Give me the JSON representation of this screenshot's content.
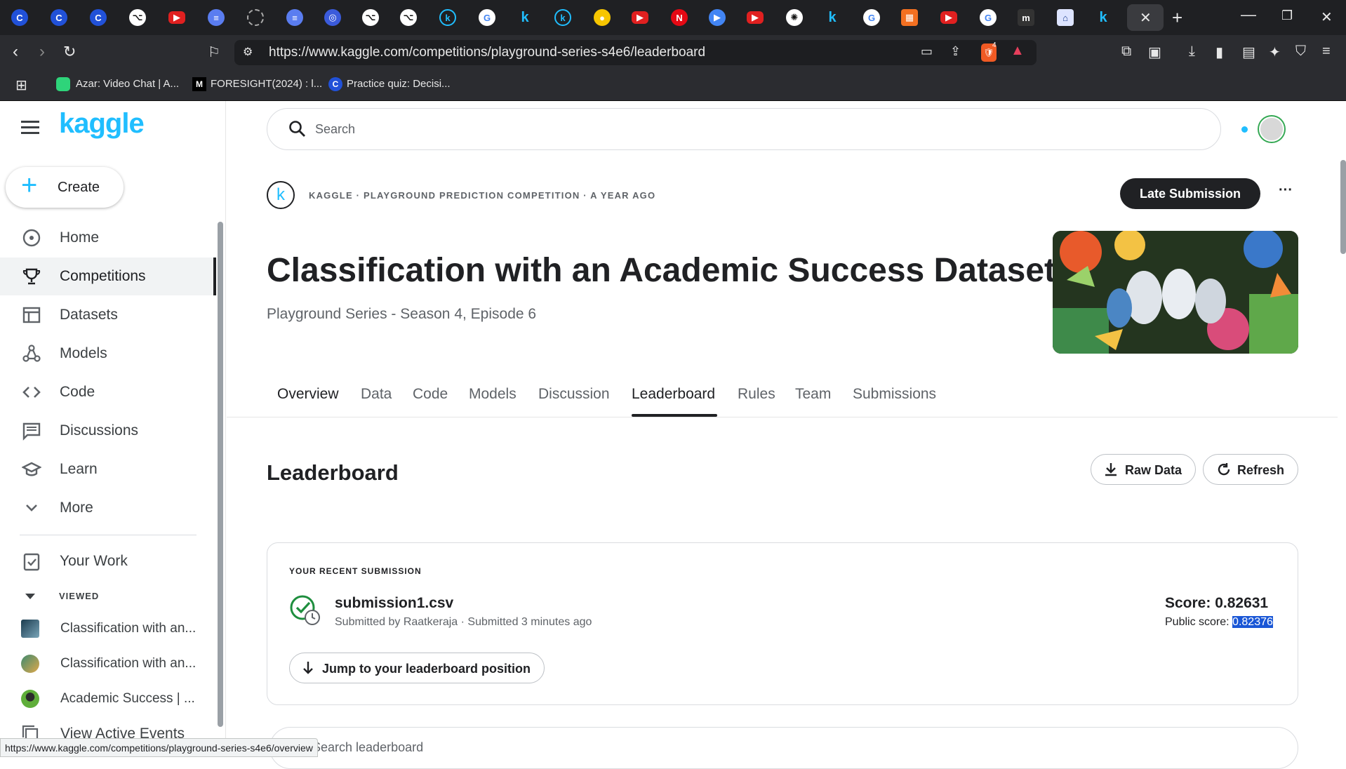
{
  "browser": {
    "url": "https://www.kaggle.com/competitions/playground-series-s4e6/leaderboard",
    "bookmarks": [
      {
        "label": "Azar: Video Chat | A..."
      },
      {
        "label": "FORESIGHT(2024) : l..."
      },
      {
        "label": "Practice quiz: Decisi..."
      }
    ],
    "status_url": "https://www.kaggle.com/competitions/playground-series-s4e6/overview",
    "shield_count": "4"
  },
  "sidebar": {
    "logo": "kaggle",
    "create_label": "Create",
    "items": [
      {
        "label": "Home",
        "icon": "compass-icon"
      },
      {
        "label": "Competitions",
        "icon": "trophy-icon"
      },
      {
        "label": "Datasets",
        "icon": "table-icon"
      },
      {
        "label": "Models",
        "icon": "models-icon"
      },
      {
        "label": "Code",
        "icon": "code-icon"
      },
      {
        "label": "Discussions",
        "icon": "discussion-icon"
      },
      {
        "label": "Learn",
        "icon": "school-icon"
      },
      {
        "label": "More",
        "icon": "chevron-down-icon"
      }
    ],
    "your_work": "Your Work",
    "viewed_heading": "VIEWED",
    "viewed": [
      {
        "label": "Classification with an..."
      },
      {
        "label": "Classification with an..."
      },
      {
        "label": "Academic Success | ..."
      }
    ],
    "view_active_events": "View Active Events"
  },
  "header": {
    "search_placeholder": "Search"
  },
  "competition": {
    "meta": "KAGGLE · PLAYGROUND PREDICTION COMPETITION · A YEAR AGO",
    "late_submission": "Late Submission",
    "more": "···",
    "title": "Classification with an Academic Success Dataset",
    "subtitle": "Playground Series - Season 4, Episode 6",
    "tabs": [
      "Overview",
      "Data",
      "Code",
      "Models",
      "Discussion",
      "Leaderboard",
      "Rules",
      "Team",
      "Submissions"
    ],
    "active_tab": "Leaderboard"
  },
  "leaderboard": {
    "heading": "Leaderboard",
    "raw_data": "Raw Data",
    "refresh": "Refresh",
    "recent_heading": "YOUR RECENT SUBMISSION",
    "file_name": "submission1.csv",
    "submitted_by": "Submitted by Raatkeraja · Submitted 3 minutes ago",
    "score": "Score: 0.82631",
    "public_score_label": "Public score: ",
    "public_score_value": "0.82376",
    "jump_label": "Jump to your leaderboard position",
    "search_leaderboard": "Search leaderboard"
  },
  "colors": {
    "kaggle_blue": "#20beff",
    "dark_button": "#202124",
    "selection": "#1a57d6",
    "success_green": "#1e8e3e"
  }
}
